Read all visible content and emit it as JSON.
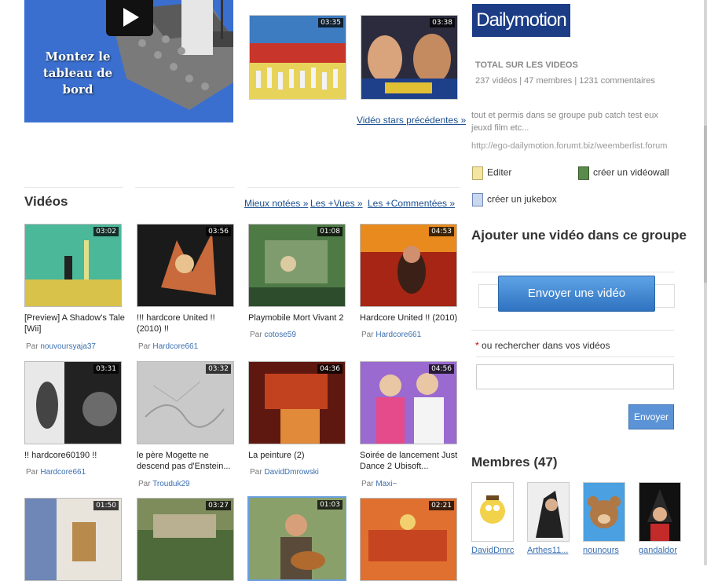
{
  "promo": {
    "text": "Montez le tableau de bord"
  },
  "top_videos": [
    {
      "duration": "03:35"
    },
    {
      "duration": "03:38"
    }
  ],
  "prev_link": "Vidéo stars précédentes »",
  "videos_section": {
    "title": "Vidéos",
    "tabs": [
      "Mieux notées »",
      "Les +Vues »",
      "Les +Commentées »"
    ]
  },
  "videos": [
    {
      "duration": "03:02",
      "title": "[Preview] A Shadow's Tale [Wii]",
      "by": "Par",
      "author": "nouvoursyaja37"
    },
    {
      "duration": "03:56",
      "title": "!!! hardcore United !! (2010) !!",
      "by": "Par",
      "author": "Hardcore661"
    },
    {
      "duration": "01:08",
      "title": "Playmobile Mort Vivant 2",
      "by": "Par",
      "author": "cotose59"
    },
    {
      "duration": "04:53",
      "title": "Hardcore United !! (2010)",
      "by": "Par",
      "author": "Hardcore661"
    },
    {
      "duration": "03:31",
      "title": "!! hardcore60190 !!",
      "by": "Par",
      "author": "Hardcore661"
    },
    {
      "duration": "03:32",
      "title": "le père Mogette ne descend pas d'Enstein...",
      "by": "Par",
      "author": "Trouduk29"
    },
    {
      "duration": "04:36",
      "title": "La peinture (2)",
      "by": "Par",
      "author": "DavidDmrowski"
    },
    {
      "duration": "04:56",
      "title": "Soirée de lancement Just Dance 2 Ubisoft...",
      "by": "Par",
      "author": "Maxi~"
    },
    {
      "duration": "01:50",
      "title": "",
      "by": "",
      "author": ""
    },
    {
      "duration": "03:27",
      "title": "",
      "by": "",
      "author": ""
    },
    {
      "duration": "01:03",
      "title": "",
      "by": "",
      "author": ""
    },
    {
      "duration": "02:21",
      "title": "",
      "by": "",
      "author": ""
    }
  ],
  "sidebar": {
    "logo": "Dailymotion",
    "stats_heading": "TOTAL SUR LES VIDEOS",
    "stats": "237 vidéos | 47 membres | 1231 commentaires",
    "description": "tout et permis dans se groupe pub catch test eux jeuxd film etc...",
    "url": "http://ego-dailymotion.forumt.biz/weemberlist.forum",
    "actions": {
      "edit": "Editer",
      "wall": "créer un vidéowall",
      "jukebox": "créer un jukebox"
    },
    "add_heading": "Ajouter une vidéo dans ce groupe",
    "upload_button": "Envoyer une vidéo",
    "search_required": "*",
    "search_label": "ou rechercher dans vos vidéos",
    "search_value": "",
    "send_button": "Envoyer",
    "members_heading": "Membres (47)",
    "members": [
      "DavidDmrc",
      "Arthes11...",
      "nounours",
      "gandaldor"
    ]
  },
  "colors": {
    "link": "#1a4f8f",
    "logo_bg": "#1c3d86",
    "button": "#2f72c0"
  }
}
